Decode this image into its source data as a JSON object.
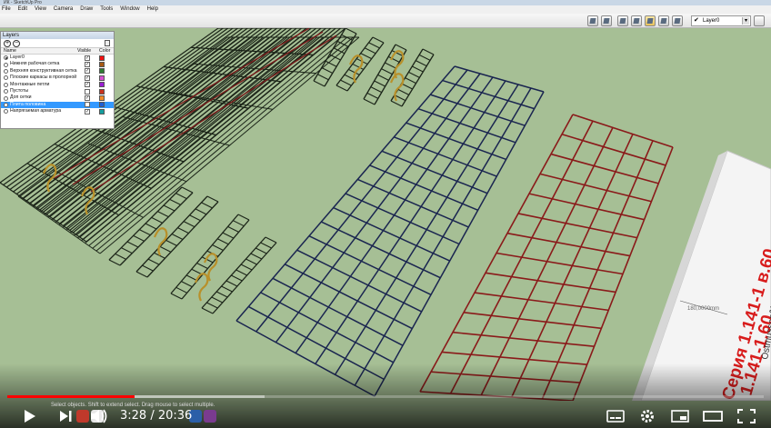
{
  "window": {
    "title": "ИК - SketchUp Pro"
  },
  "menu": [
    "File",
    "Edit",
    "View",
    "Camera",
    "Draw",
    "Tools",
    "Window",
    "Help"
  ],
  "toolbar": {
    "layer_combo_value": "Layer0",
    "icons": [
      "shaded-box-icon",
      "textured-box-icon",
      "xray-icon",
      "wireframe-icon",
      "hidden-line-icon",
      "shaded-icon",
      "shaded-textures-icon",
      "monochrome-icon"
    ]
  },
  "layers_panel": {
    "title": "Layers",
    "columns": {
      "name": "Name",
      "visible": "Visible",
      "color": "Color"
    },
    "rows": [
      {
        "name": "Layer0",
        "active": true,
        "visible": true,
        "color": "#f20f0f"
      },
      {
        "name": "Нижняя рабочая сетка",
        "active": false,
        "visible": true,
        "color": "#a85a14"
      },
      {
        "name": "Верхняя конструктивная сетка",
        "active": false,
        "visible": true,
        "color": "#2e7d32"
      },
      {
        "name": "Плоские каркасы в пролорной з",
        "active": false,
        "visible": true,
        "color": "#d84fd0"
      },
      {
        "name": "Монтажные петли",
        "active": false,
        "visible": true,
        "color": "#9a1fd4"
      },
      {
        "name": "Пустоты",
        "active": false,
        "visible": false,
        "color": "#c8321e"
      },
      {
        "name": "Доп сетки",
        "active": false,
        "visible": true,
        "color": "#f28c28"
      },
      {
        "name": "Плита половина",
        "active": false,
        "visible": false,
        "color": "#1f5fd6",
        "selected": true
      },
      {
        "name": "Напрягаемая арматура",
        "active": false,
        "visible": true,
        "color": "#149e9e"
      }
    ]
  },
  "viewport": {
    "dimension_label": "180,0000mm",
    "slab_text_1": "Серия 1.141-1 в.60",
    "slab_text_2": "1.141-1.60",
    "slab_text_3": "Ostmussen/Weberburg",
    "colors": {
      "background": "#a6bf95",
      "black_grid": "#1b2418",
      "blue_grid": "#1a2550",
      "red_grid": "#8a1a1a",
      "loops": "#b8902a"
    }
  },
  "status_bar": {
    "text": "Select objects. Shift to extend select. Drag mouse to select multiple."
  },
  "player": {
    "current_time": "3:28",
    "separator": " / ",
    "duration": "20:36",
    "played_fraction": 0.168,
    "loaded_fraction": 0.34
  }
}
